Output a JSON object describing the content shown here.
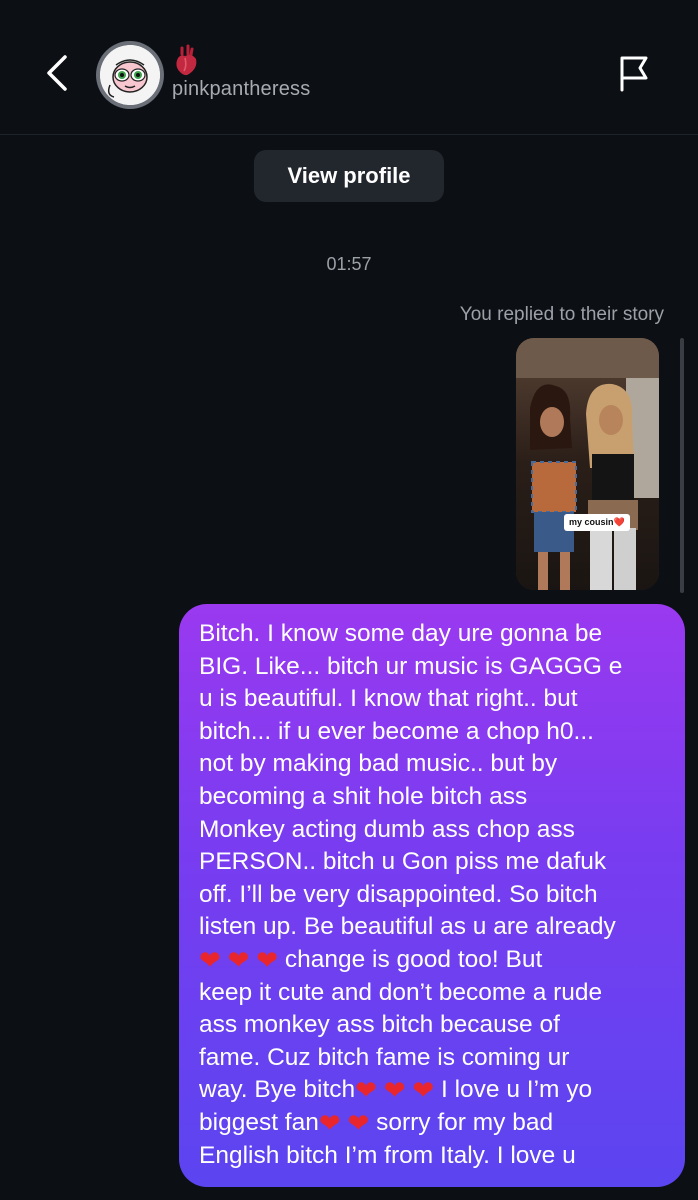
{
  "header": {
    "back_label": "Back",
    "username": "pinkpantheress",
    "note_icon": "anatomical-heart-icon",
    "flag_icon": "flag-icon"
  },
  "thread": {
    "view_profile_label": "View profile",
    "timestamp": "01:57",
    "reply_note": "You replied to their story",
    "story_sticker": "my cousin❤️"
  },
  "message": {
    "lines": [
      "Bitch. I know some day ure gonna be",
      "BIG. Like... bitch ur music is GAGGG e",
      "u is beautiful. I know that right.. but",
      "bitch... if u ever become a chop h0...",
      "not by making bad music.. but by",
      "becoming a shit hole bitch ass",
      "Monkey acting dumb ass chop ass",
      "PERSON.. bitch u Gon piss me dafuk",
      "off. I’ll be very disappointed. So bitch",
      "listen up. Be beautiful as u are already"
    ],
    "line11_after_hearts": "change is good too! But",
    "line12": "keep it cute and don’t become a rude",
    "line13": "ass monkey ass bitch because of",
    "line14": "fame. Cuz bitch fame is coming ur",
    "line15_before_hearts": "way. Bye bitch",
    "line15_after_hearts": "I love u I’m yo",
    "line16_before_hearts": "biggest fan",
    "line16_after_hearts": "sorry for my bad",
    "line17": "English bitch I’m from Italy. I love u"
  },
  "colors": {
    "background": "#0c0f14",
    "bubble_gradient_top": "#9a39f0",
    "bubble_gradient_bottom": "#5b45f0",
    "heart": "#e8262c"
  }
}
